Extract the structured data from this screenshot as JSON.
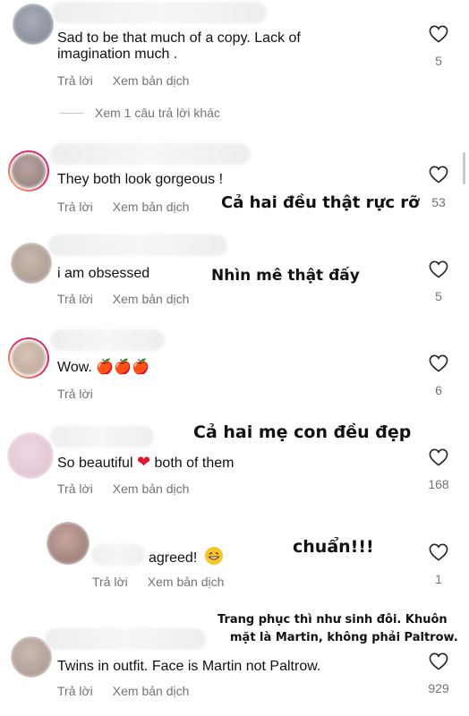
{
  "actions": {
    "reply": "Trả lời",
    "translate": "Xem bản dịch"
  },
  "more_replies": "Xem 1 câu trả lời khác",
  "comments": [
    {
      "text_line1": "Sad to be that much of a copy. Lack of",
      "text_line2": "imagination much .",
      "likes": "5"
    },
    {
      "text": "They both look gorgeous !",
      "likes": "53",
      "overlay": "Cả hai đều thật rực rỡ"
    },
    {
      "text": "i am obsessed",
      "likes": "5",
      "overlay": "Nhìn mê thật đấy"
    },
    {
      "text": "Wow.",
      "emojis": "🍎🍎🍎",
      "likes": "6"
    },
    {
      "text_before": "So beautiful",
      "emoji": "❤",
      "text_after": "both of them",
      "likes": "168",
      "overlay": "Cả hai mẹ con đều đẹp"
    },
    {
      "text": "agreed!",
      "likes": "1",
      "overlay": "chuẩn!!!"
    },
    {
      "text": "Twins in outfit.  Face is Martin not Paltrow.",
      "likes": "929",
      "overlay_line1": "Trang phục thì như sinh đôi. Khuôn",
      "overlay_line2": "mặt là Martin, không phải Paltrow."
    }
  ],
  "colors": {
    "meta_text": "#737373",
    "story_ring": "#e1306c",
    "heart_outline": "#262626"
  }
}
